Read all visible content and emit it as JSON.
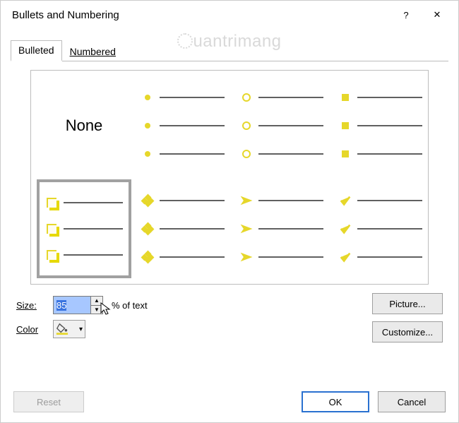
{
  "window": {
    "title": "Bullets and Numbering",
    "help_glyph": "?",
    "close_glyph": "✕"
  },
  "tabs": {
    "bulleted": "Bulleted",
    "numbered": "Numbered"
  },
  "options": {
    "none_label": "None"
  },
  "size": {
    "label": "Size:",
    "value": "85",
    "suffix": "% of text"
  },
  "color": {
    "label": "Color",
    "swatch": "#e6d72a"
  },
  "buttons": {
    "picture": "Picture...",
    "customize": "Customize...",
    "reset": "Reset",
    "ok": "OK",
    "cancel": "Cancel"
  },
  "watermark": "uantrimang"
}
